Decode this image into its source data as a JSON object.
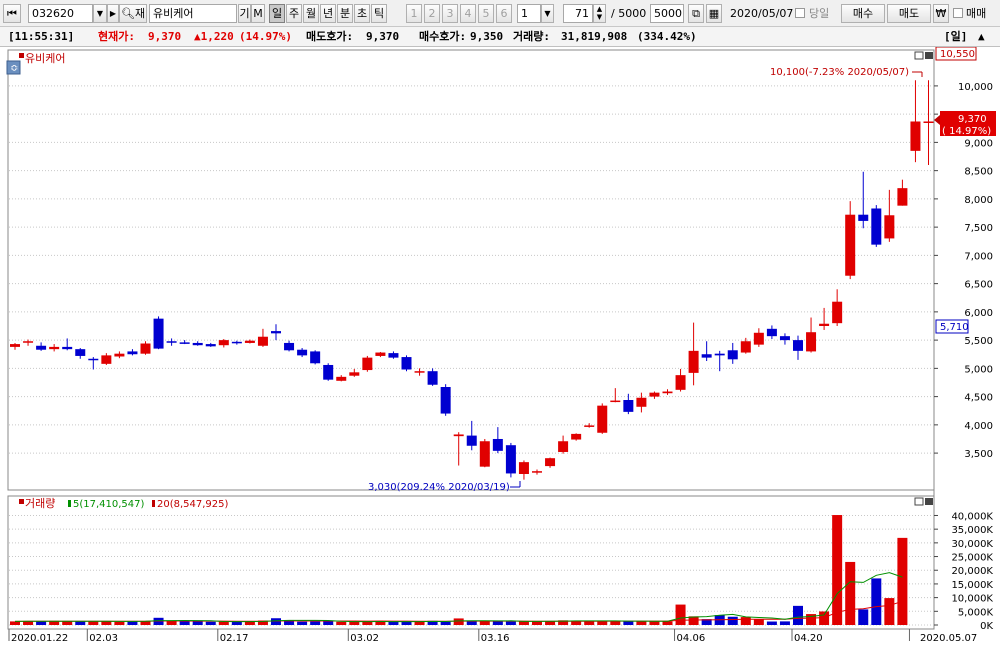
{
  "toolbar": {
    "code": "032620",
    "name": "유비케어",
    "btn_jae": "재",
    "btn_gi": "기",
    "btn_m": "M",
    "periods": [
      "일",
      "주",
      "월",
      "년",
      "분",
      "초",
      "틱"
    ],
    "selected_period": "일",
    "numbers": [
      "1",
      "2",
      "3",
      "4",
      "5",
      "6"
    ],
    "num_select": "1",
    "count": "71",
    "slash_total": "/  5000",
    "total_box": "5000",
    "date": "2020/05/07",
    "today_label": "당일",
    "buy_label": "매수",
    "sell_label": "매도",
    "won_label": "₩",
    "trade_label": "매매"
  },
  "infobar": {
    "time": "[11:55:31]",
    "cur_label": "현재가:",
    "cur_value": "9,370",
    "change": "▲1,220",
    "change_pct": "(14.97%)",
    "ask_label": "매도호가:",
    "ask_value": "9,370",
    "bid_label": "매수호가:",
    "bid_value": "9,350",
    "vol_label": "거래량:",
    "vol_value": "31,819,908",
    "vol_pct": "(334.42%)",
    "period_tag": "[일]"
  },
  "price_chart": {
    "title": "유비케어",
    "ytick_labels": [
      "10,000",
      "9,500",
      "9,000",
      "8,500",
      "8,000",
      "7,500",
      "7,000",
      "6,500",
      "6,000",
      "5,500",
      "5,000",
      "4,500",
      "4,000",
      "3,500"
    ],
    "high_annotation": "10,100(-7.23% 2020/05/07)",
    "low_annotation": "3,030(209.24% 2020/03/19)",
    "axis_max_label": "10,550",
    "axis_min_label": "5,710",
    "cur_price_label": "9,370",
    "cur_pct_label": "( 14.97%)"
  },
  "volume_chart": {
    "title": "거래량",
    "ma5_label": "5(17,410,547)",
    "ma20_label": "20(8,547,925)",
    "ytick_labels": [
      "40,000K",
      "35,000K",
      "30,000K",
      "25,000K",
      "20,000K",
      "15,000K",
      "10,000K",
      "5,000K",
      "0K"
    ]
  },
  "xaxis_dates": [
    "2020.01.22",
    "02.03",
    "02.17",
    "03.02",
    "03.16",
    "04.06",
    "04.20",
    "2020.05.07"
  ],
  "colors": {
    "up": "#e00000",
    "down": "#0000d0",
    "ma5": "#009000",
    "ma20": "#e00000",
    "grid": "#c8c8c8"
  },
  "chart_data": {
    "type": "candlestick",
    "price_range": [
      3030,
      10550
    ],
    "volume_unit": "K shares",
    "volume_range": [
      0,
      42000
    ],
    "candles": [
      {
        "d": "01.22",
        "o": 5380,
        "h": 5450,
        "l": 5330,
        "c": 5430
      },
      {
        "d": "01.23",
        "o": 5470,
        "h": 5510,
        "l": 5400,
        "c": 5480
      },
      {
        "d": "01.28",
        "o": 5400,
        "h": 5460,
        "l": 5310,
        "c": 5330
      },
      {
        "d": "01.29",
        "o": 5340,
        "h": 5430,
        "l": 5300,
        "c": 5380
      },
      {
        "d": "01.30",
        "o": 5380,
        "h": 5530,
        "l": 5320,
        "c": 5340
      },
      {
        "d": "01.31",
        "o": 5340,
        "h": 5360,
        "l": 5170,
        "c": 5220
      },
      {
        "d": "02.03",
        "o": 5170,
        "h": 5200,
        "l": 4980,
        "c": 5160
      },
      {
        "d": "02.04",
        "o": 5080,
        "h": 5270,
        "l": 5060,
        "c": 5230
      },
      {
        "d": "02.05",
        "o": 5210,
        "h": 5300,
        "l": 5180,
        "c": 5260
      },
      {
        "d": "02.06",
        "o": 5300,
        "h": 5340,
        "l": 5230,
        "c": 5250
      },
      {
        "d": "02.07",
        "o": 5260,
        "h": 5480,
        "l": 5240,
        "c": 5440
      },
      {
        "d": "02.10",
        "o": 5880,
        "h": 5920,
        "l": 5340,
        "c": 5350
      },
      {
        "d": "02.11",
        "o": 5480,
        "h": 5530,
        "l": 5400,
        "c": 5460
      },
      {
        "d": "02.12",
        "o": 5460,
        "h": 5500,
        "l": 5430,
        "c": 5440
      },
      {
        "d": "02.13",
        "o": 5450,
        "h": 5480,
        "l": 5400,
        "c": 5410
      },
      {
        "d": "02.14",
        "o": 5430,
        "h": 5450,
        "l": 5380,
        "c": 5390
      },
      {
        "d": "02.17",
        "o": 5410,
        "h": 5520,
        "l": 5370,
        "c": 5500
      },
      {
        "d": "02.18",
        "o": 5470,
        "h": 5490,
        "l": 5420,
        "c": 5460
      },
      {
        "d": "02.19",
        "o": 5450,
        "h": 5510,
        "l": 5440,
        "c": 5490
      },
      {
        "d": "02.20",
        "o": 5400,
        "h": 5700,
        "l": 5380,
        "c": 5560
      },
      {
        "d": "02.21",
        "o": 5660,
        "h": 5780,
        "l": 5500,
        "c": 5620
      },
      {
        "d": "02.24",
        "o": 5450,
        "h": 5490,
        "l": 5300,
        "c": 5320
      },
      {
        "d": "02.25",
        "o": 5330,
        "h": 5360,
        "l": 5200,
        "c": 5230
      },
      {
        "d": "02.26",
        "o": 5300,
        "h": 5320,
        "l": 5070,
        "c": 5090
      },
      {
        "d": "02.27",
        "o": 5060,
        "h": 5090,
        "l": 4780,
        "c": 4800
      },
      {
        "d": "02.28",
        "o": 4780,
        "h": 4880,
        "l": 4770,
        "c": 4850
      },
      {
        "d": "03.02",
        "o": 4870,
        "h": 4990,
        "l": 4850,
        "c": 4930
      },
      {
        "d": "03.03",
        "o": 4970,
        "h": 5220,
        "l": 4940,
        "c": 5190
      },
      {
        "d": "03.04",
        "o": 5220,
        "h": 5290,
        "l": 5200,
        "c": 5280
      },
      {
        "d": "03.05",
        "o": 5270,
        "h": 5300,
        "l": 5170,
        "c": 5190
      },
      {
        "d": "03.06",
        "o": 5200,
        "h": 5230,
        "l": 4950,
        "c": 4980
      },
      {
        "d": "03.09",
        "o": 4940,
        "h": 5000,
        "l": 4870,
        "c": 4950
      },
      {
        "d": "03.10",
        "o": 4950,
        "h": 5000,
        "l": 4690,
        "c": 4710
      },
      {
        "d": "03.11",
        "o": 4670,
        "h": 4720,
        "l": 4160,
        "c": 4200
      },
      {
        "d": "03.12",
        "o": 3800,
        "h": 3870,
        "l": 3280,
        "c": 3830
      },
      {
        "d": "03.13",
        "o": 3810,
        "h": 4070,
        "l": 3550,
        "c": 3630
      },
      {
        "d": "03.16",
        "o": 3260,
        "h": 3750,
        "l": 3250,
        "c": 3710
      },
      {
        "d": "03.17",
        "o": 3750,
        "h": 3960,
        "l": 3500,
        "c": 3540
      },
      {
        "d": "03.18",
        "o": 3640,
        "h": 3680,
        "l": 3070,
        "c": 3140
      },
      {
        "d": "03.19",
        "o": 3130,
        "h": 3370,
        "l": 3030,
        "c": 3340
      },
      {
        "d": "03.20",
        "o": 3160,
        "h": 3210,
        "l": 3120,
        "c": 3180
      },
      {
        "d": "03.23",
        "o": 3270,
        "h": 3420,
        "l": 3240,
        "c": 3410
      },
      {
        "d": "03.24",
        "o": 3520,
        "h": 3810,
        "l": 3490,
        "c": 3710
      },
      {
        "d": "03.25",
        "o": 3740,
        "h": 3850,
        "l": 3720,
        "c": 3840
      },
      {
        "d": "03.26",
        "o": 3980,
        "h": 4030,
        "l": 3950,
        "c": 3990
      },
      {
        "d": "03.27",
        "o": 3860,
        "h": 4380,
        "l": 3840,
        "c": 4340
      },
      {
        "d": "03.30",
        "o": 4420,
        "h": 4650,
        "l": 4400,
        "c": 4430
      },
      {
        "d": "03.31",
        "o": 4440,
        "h": 4550,
        "l": 4190,
        "c": 4230
      },
      {
        "d": "04.01",
        "o": 4320,
        "h": 4570,
        "l": 4220,
        "c": 4480
      },
      {
        "d": "04.02",
        "o": 4500,
        "h": 4590,
        "l": 4460,
        "c": 4570
      },
      {
        "d": "04.03",
        "o": 4560,
        "h": 4630,
        "l": 4530,
        "c": 4590
      },
      {
        "d": "04.06",
        "o": 4620,
        "h": 4990,
        "l": 4590,
        "c": 4880
      },
      {
        "d": "04.07",
        "o": 4920,
        "h": 5810,
        "l": 4700,
        "c": 5310
      },
      {
        "d": "04.08",
        "o": 5250,
        "h": 5480,
        "l": 5130,
        "c": 5190
      },
      {
        "d": "04.09",
        "o": 5260,
        "h": 5310,
        "l": 4950,
        "c": 5230
      },
      {
        "d": "04.10",
        "o": 5320,
        "h": 5450,
        "l": 5080,
        "c": 5160
      },
      {
        "d": "04.13",
        "o": 5280,
        "h": 5540,
        "l": 5260,
        "c": 5480
      },
      {
        "d": "04.14",
        "o": 5420,
        "h": 5710,
        "l": 5380,
        "c": 5630
      },
      {
        "d": "04.16",
        "o": 5700,
        "h": 5760,
        "l": 5520,
        "c": 5570
      },
      {
        "d": "04.17",
        "o": 5570,
        "h": 5620,
        "l": 5420,
        "c": 5500
      },
      {
        "d": "04.20",
        "o": 5500,
        "h": 5580,
        "l": 5150,
        "c": 5310
      },
      {
        "d": "04.21",
        "o": 5300,
        "h": 5900,
        "l": 5280,
        "c": 5640
      },
      {
        "d": "04.22",
        "o": 5750,
        "h": 6070,
        "l": 5680,
        "c": 5790
      },
      {
        "d": "04.23",
        "o": 5800,
        "h": 6400,
        "l": 5750,
        "c": 6180
      },
      {
        "d": "04.24",
        "o": 6640,
        "h": 7960,
        "l": 6580,
        "c": 7720
      },
      {
        "d": "04.27",
        "o": 7720,
        "h": 8480,
        "l": 7480,
        "c": 7610
      },
      {
        "d": "04.28",
        "o": 7830,
        "h": 7890,
        "l": 7150,
        "c": 7190
      },
      {
        "d": "04.29",
        "o": 7300,
        "h": 8160,
        "l": 7240,
        "c": 7710
      },
      {
        "d": "04.30",
        "o": 7880,
        "h": 8340,
        "l": 7880,
        "c": 8190
      },
      {
        "d": "05.06",
        "o": 8850,
        "h": 10100,
        "l": 8650,
        "c": 9370
      },
      {
        "d": "05.07",
        "o": 9370,
        "h": 10100,
        "l": 8600,
        "c": 9370
      }
    ],
    "volume": [
      1310,
      1450,
      1280,
      1500,
      1390,
      1270,
      1370,
      1400,
      1160,
      1460,
      1410,
      2630,
      1360,
      1290,
      1330,
      1180,
      1230,
      1190,
      1250,
      1640,
      2470,
      1830,
      1200,
      1260,
      1370,
      1190,
      1180,
      1170,
      1410,
      1230,
      1140,
      1310,
      1510,
      1170,
      2400,
      1400,
      1320,
      1280,
      1260,
      1310,
      1470,
      1420,
      1710,
      1510,
      1400,
      1380,
      1510,
      1400,
      1440,
      1270,
      1280,
      7460,
      3160,
      2140,
      3610,
      3010,
      2890,
      2010,
      1270,
      1320,
      6990,
      3990,
      4940,
      40160,
      23030,
      5700,
      17010,
      9830,
      31820,
      0
    ],
    "last_vol_side": [
      1,
      1,
      -1,
      1,
      1,
      -1,
      1,
      1,
      1,
      -1,
      1,
      -1,
      1,
      -1,
      -1,
      -1,
      1,
      -1,
      1,
      1,
      -1,
      -1,
      -1,
      -1,
      -1,
      1,
      1,
      1,
      1,
      -1,
      -1,
      1,
      -1,
      -1,
      1,
      -1,
      1,
      -1,
      -1,
      1,
      1,
      1,
      1,
      1,
      1,
      1,
      1,
      -1,
      1,
      1,
      1,
      1,
      1,
      -1,
      -1,
      -1,
      1,
      1,
      -1,
      -1,
      -1,
      1,
      1,
      1,
      1,
      -1,
      -1,
      1,
      1,
      1,
      0
    ]
  }
}
